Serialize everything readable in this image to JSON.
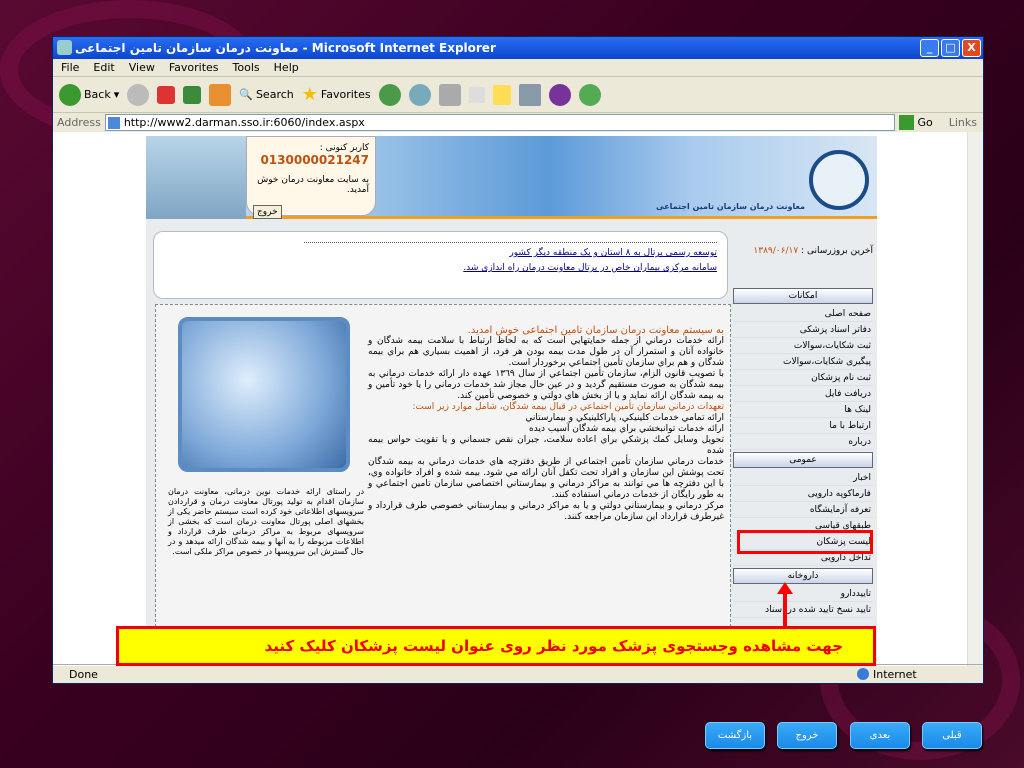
{
  "window": {
    "title": "معاونت درمان سازمان تامین اجتماعی - Microsoft Internet Explorer"
  },
  "menu": [
    "File",
    "Edit",
    "View",
    "Favorites",
    "Tools",
    "Help"
  ],
  "toolbar": {
    "back": "Back",
    "search": "Search",
    "favorites": "Favorites"
  },
  "address": {
    "label": "Address",
    "url": "http://www2.darman.sso.ir:6060/index.aspx",
    "go": "Go",
    "links": "Links"
  },
  "header": {
    "user_label": "کاربر کنونی :",
    "user_id": "0130000021247",
    "welcome": "به سایت معاونت درمان خوش آمدید.",
    "logout": "خروج",
    "logo_text": "معاونت درمان سازمان تامین اجتماعی"
  },
  "news": [
    "توسعه رسمی پرتال به ۸ استان و یک منطقه دیگر کشور",
    "سامانه مرکزی بیماران خاص در پرتال معاونت درمان راه اندازی شد."
  ],
  "update": {
    "label": "آخرین بروزرسانی :",
    "date": "۱۳۸۹/۰۶/۱۷"
  },
  "sidebar": {
    "sections": [
      {
        "title": "امکانات",
        "items": [
          "صفحه اصلی",
          "دفاتر اسناد پزشکی",
          "ثبت شکایات،سوالات",
          "پیگیری شکایات،سوالات",
          "ثبت نام پزشکان",
          "دریافت فایل",
          "لینک ها",
          "ارتباط با ما",
          "درباره"
        ]
      },
      {
        "title": "عمومی",
        "items": [
          "اخبار",
          "فارماکوپه دارویی",
          "تعرفه آزمایشگاه",
          "طبقهای قیاسی",
          "لیست پزشکان",
          "تداخل دارویی"
        ]
      },
      {
        "title": "داروخانه",
        "items": [
          "تاییددارو",
          "تایید نسخ تایید شده در اسناد"
        ]
      }
    ]
  },
  "left_text": "در راستای ارائه خدمات نوین درمانی، معاونت درمان سازمان اقدام به تولید پورتال معاونت درمان و قراردادن سرویسهای اطلاعاتی خود کرده است سیستم حاضر یکی از بخشهای اصلی پورتال معاونت درمان است که بخشی از سرویسهای مربوط به مراکز درمانی طرف قرارداد و اطلاعات مربوطه را به آنها و بیمه شدگان ارائه میدهد و در حال گسترش این سرویسها در خصوص مراکز ملکی است.",
  "main_text": {
    "heading": "به سیستم معاونت درمان سازمان تامین اجتماعی خوش امدید.",
    "p1": "ارائه خدمات درماني از جمله حمايتهايي است كه به لحاظ ارتباط با سلامت بيمه شدگان و خانواده آنان و استمرار آن در طول مدت بيمه بودن هر فرد، از اهميت بسياري هم براي بيمه شدگان و هم براي سازمان تأمين اجتماعي برخوردار است.",
    "p2": "با تصويب قانون الزام، سازمان تأمين اجتماعي از سال ١٣٦٩ عهده دار ارائه خدمات درماني به بيمه شدگان به صورت مستقيم گرديد و در عين حال مجاز شد خدمات درماني را يا خود تأمين و به بيمه شدگان ارائه نمايد و يا از بخش هاي دولتي و خصوصي تأمين كند.",
    "subheading": "تعهدات درماني سازمان تأمين اجتماعي در قبال بيمه شدگان، شامل موارد زير است:",
    "items": [
      "ارائه تمامي خدمات كلينيكي، پاراكلينيكي و بيمارستاني",
      "ارائه خدمات توانبخشي براي بيمه شدگان آسيب ديده",
      "تحويل وسايل كمك پزشكي براي اعاده سلامت، جبران نقص جسماني و يا تقويت حواس بيمه شده"
    ],
    "p3": "خدمات درماني سازمان تأمين اجتماعي از طريق دفترچه هاي خدمات درماني به بيمه شدگان تحت پوشش اين سازمان و افراد تحت تكفل آنان ارائه مي شود. بيمه شده و افراد خانواده وي، با اين دفترچه ها مي توانند به مراكز درماني و بيمارستاني اختصاصي سازمان تامين اجتماعي و به طور رايگان از خدمات درماني استفاده كنند.",
    "p4": "مركز درماني و بيمارستاني دولتي و يا به مراكز درماني و بيمارستاني خصوصي طرف قرارداد و غيرطرف قرارداد اين سازمان مراجعه كنند."
  },
  "status": {
    "left": "Done",
    "right": "Internet"
  },
  "instruction": "جهت مشاهده وجستجوی پزشک  مورد نظر روی عنوان لیست پزشکان کلیک کنید",
  "nav_buttons": {
    "back": "بازگشت",
    "exit": "خروج",
    "next": "بعدی",
    "prev": "قبلی"
  }
}
